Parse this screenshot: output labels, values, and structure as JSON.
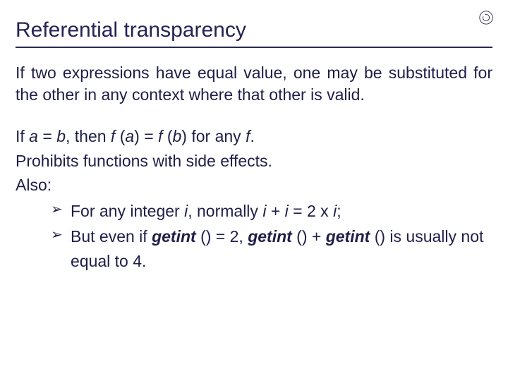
{
  "title": "Referential transparency",
  "paragraph": "If two expressions have equal value, one may be substituted for the other in any context where that other is valid.",
  "line1_pre": "If ",
  "line1_a": "a",
  "line1_mid1": " = ",
  "line1_b": "b",
  "line1_mid2": ", then ",
  "line1_f1": "f",
  "line1_mid3": " (",
  "line1_a2": "a",
  "line1_mid4": ") = ",
  "line1_f2": "f",
  "line1_mid5": " (",
  "line1_b2": "b",
  "line1_mid6": ") for any ",
  "line1_f3": "f",
  "line1_end": ".",
  "line2": "Prohibits functions with side effects.",
  "line3": "Also:",
  "bullet1_pre": "For any integer ",
  "bullet1_i1": "i",
  "bullet1_mid1": ", normally ",
  "bullet1_i2": "i",
  "bullet1_mid2": " + ",
  "bullet1_i3": "i",
  "bullet1_mid3": " = 2 x ",
  "bullet1_i4": "i",
  "bullet1_end": ";",
  "bullet2_pre": "But even if ",
  "bullet2_g1": "getint",
  "bullet2_mid1": " () = 2, ",
  "bullet2_g2": "getint",
  "bullet2_mid2": " () + ",
  "bullet2_g3": "getint",
  "bullet2_mid3": " () is usually not equal to 4."
}
